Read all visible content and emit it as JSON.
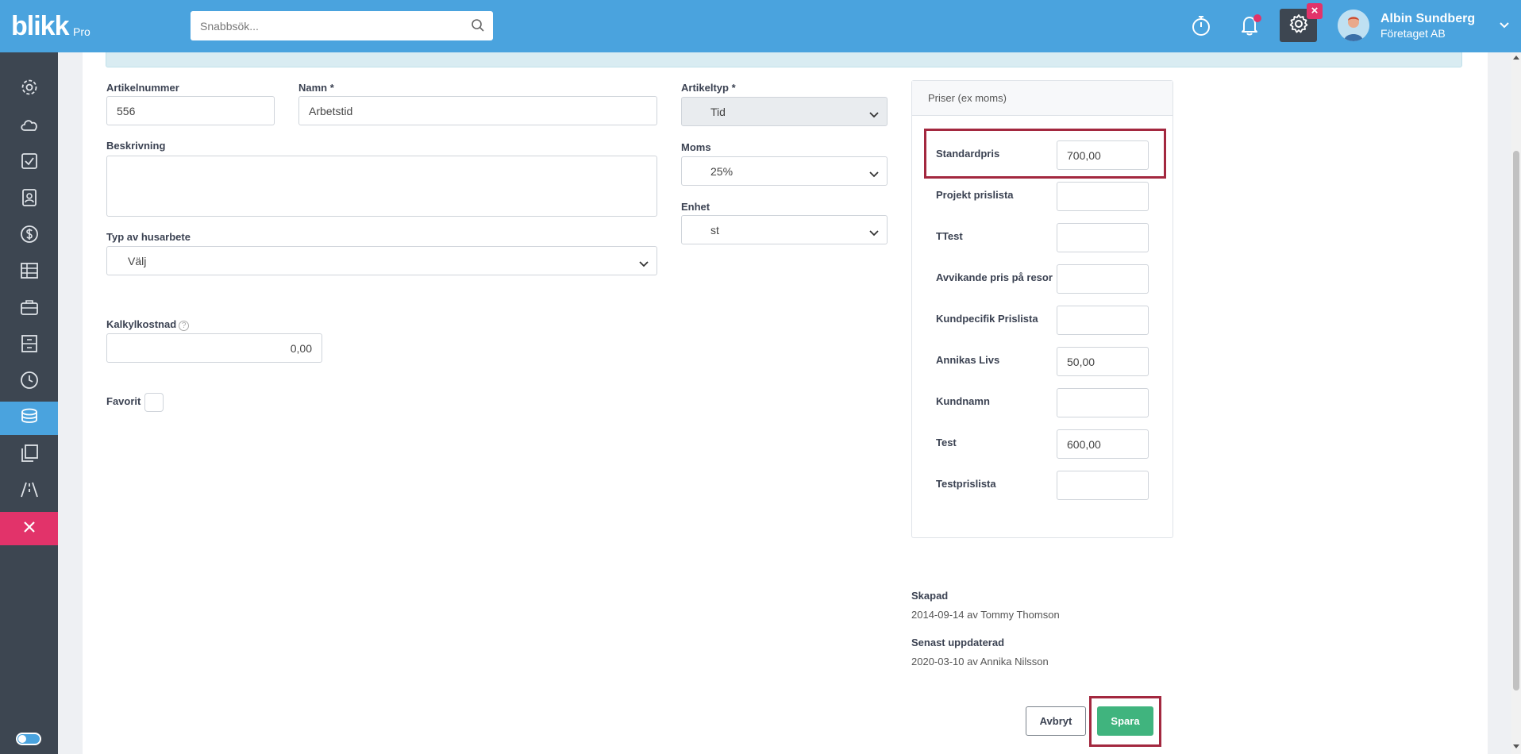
{
  "app": {
    "logo": "blikk",
    "logo_suffix": "Pro"
  },
  "search": {
    "placeholder": "Snabbsök..."
  },
  "user": {
    "name": "Albin Sundberg",
    "company": "Företaget AB"
  },
  "form": {
    "article_number": {
      "label": "Artikelnummer",
      "value": "556"
    },
    "name": {
      "label": "Namn *",
      "value": "Arbetstid"
    },
    "description": {
      "label": "Beskrivning",
      "value": ""
    },
    "article_type": {
      "label": "Artikeltyp *",
      "value": "Tid"
    },
    "vat": {
      "label": "Moms",
      "value": "25%"
    },
    "unit": {
      "label": "Enhet",
      "value": "st"
    },
    "household_work": {
      "label": "Typ av husarbete",
      "value": "Välj"
    },
    "calc_cost": {
      "label": "Kalkylkostnad",
      "value": "0,00"
    },
    "favorite": {
      "label": "Favorit"
    }
  },
  "prices": {
    "title": "Priser (ex moms)",
    "rows": [
      {
        "label": "Standardpris",
        "value": "700,00"
      },
      {
        "label": "Projekt prislista",
        "value": ""
      },
      {
        "label": "TTest",
        "value": ""
      },
      {
        "label": "Avvikande pris på resor",
        "value": ""
      },
      {
        "label": "Kundpecifik Prislista",
        "value": ""
      },
      {
        "label": "Annikas Livs",
        "value": "50,00"
      },
      {
        "label": "Kundnamn",
        "value": ""
      },
      {
        "label": "Test",
        "value": "600,00"
      },
      {
        "label": "Testprislista",
        "value": ""
      }
    ]
  },
  "meta": {
    "created_label": "Skapad",
    "created_value": "2014-09-14 av Tommy Thomson",
    "updated_label": "Senast uppdaterad",
    "updated_value": "2020-03-10 av Annika Nilsson"
  },
  "actions": {
    "cancel": "Avbryt",
    "save": "Spara"
  },
  "colors": {
    "topbar": "#4aa3de",
    "sidebar": "#3d4651",
    "accent": "#e2336a",
    "save": "#40b47e",
    "highlight": "#a3283f"
  },
  "icons": [
    "stopwatch-icon",
    "bell-icon",
    "gear-icon",
    "search-icon"
  ]
}
